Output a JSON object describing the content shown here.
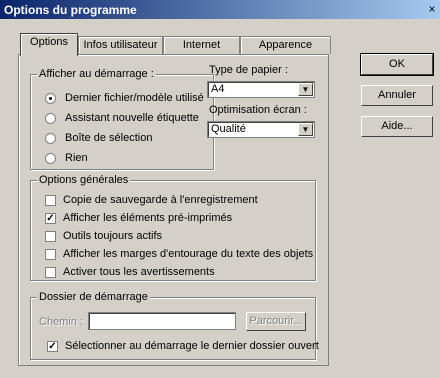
{
  "window": {
    "title": "Options du programme",
    "close": "×"
  },
  "tabs": [
    {
      "label": "Options",
      "access_key": "n",
      "active": true
    },
    {
      "label": "Infos utilisateur"
    },
    {
      "label": "Internet"
    },
    {
      "label": "Apparence"
    }
  ],
  "startup": {
    "legend": "Afficher au démarrage :",
    "options": [
      {
        "label": "Dernier fichier/modèle utilisé",
        "selected": true
      },
      {
        "label": "Assistant nouvelle étiquette",
        "selected": false
      },
      {
        "label": "Boîte de sélection",
        "selected": false
      },
      {
        "label": "Rien",
        "selected": false
      }
    ]
  },
  "paper": {
    "label": "Type de papier :",
    "value": "A4"
  },
  "screen_opt": {
    "label": "Optimisation écran :",
    "value": "Qualité"
  },
  "general": {
    "legend": "Options générales",
    "options": [
      {
        "label": "Copie de sauvegarde à l'enregistrement",
        "checked": false
      },
      {
        "label": "Afficher les éléments pré-imprimés",
        "checked": true
      },
      {
        "label": "Outils toujours actifs",
        "checked": false
      },
      {
        "label": "Afficher les marges d'entourage du texte des objets",
        "checked": false
      },
      {
        "label": "Activer tous les avertissements",
        "checked": false
      }
    ]
  },
  "folder": {
    "legend": "Dossier de démarrage",
    "path_label": "Chemin :",
    "path_value": "",
    "browse_label": "Parcourir...",
    "last_folder_label": "Sélectionner au démarrage le dernier dossier ouvert",
    "last_folder_checked": true
  },
  "buttons": {
    "ok": "OK",
    "cancel": "Annuler",
    "help": "Aide..."
  },
  "colors": {
    "title_start": "#0a246a",
    "title_end": "#a6caf0",
    "face": "#d4d0c8"
  }
}
